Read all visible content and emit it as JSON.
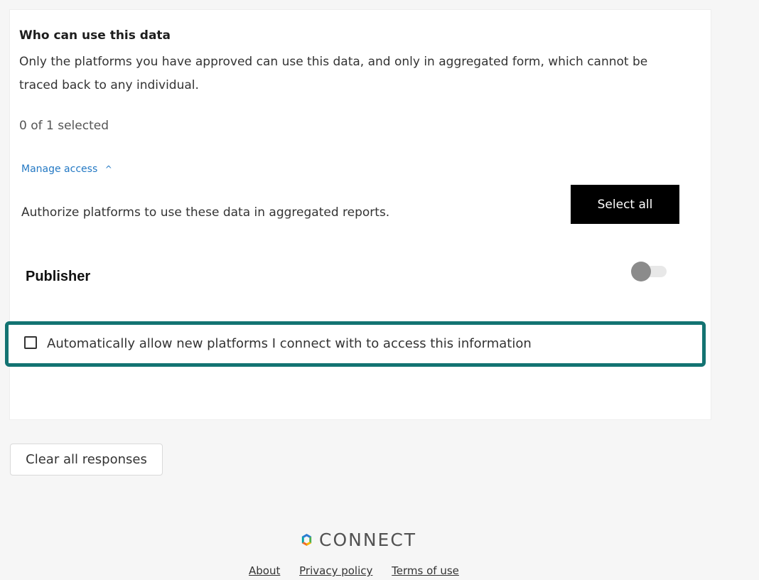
{
  "section": {
    "title": "Who can use this data",
    "description": "Only the platforms you have approved can use this data, and only in aggregated form, which cannot be traced back to any individual.",
    "selection_count": "0 of 1 selected"
  },
  "manage_access": {
    "label": "Manage access",
    "caret": "^"
  },
  "authorize": {
    "text": "Authorize platforms to use these data in aggregated reports.",
    "select_all_label": "Select all"
  },
  "platforms": [
    {
      "label": "Publisher",
      "enabled": false
    }
  ],
  "auto_allow": {
    "label": "Automatically allow new platforms I connect with to access this information",
    "checked": false
  },
  "actions": {
    "clear_label": "Clear all responses"
  },
  "footer": {
    "brand": "CONNECT",
    "links": [
      "About",
      "Privacy policy",
      "Terms of use"
    ]
  },
  "colors": {
    "highlight_border": "#137372",
    "link": "#2479c4",
    "button_primary": "#000000"
  }
}
